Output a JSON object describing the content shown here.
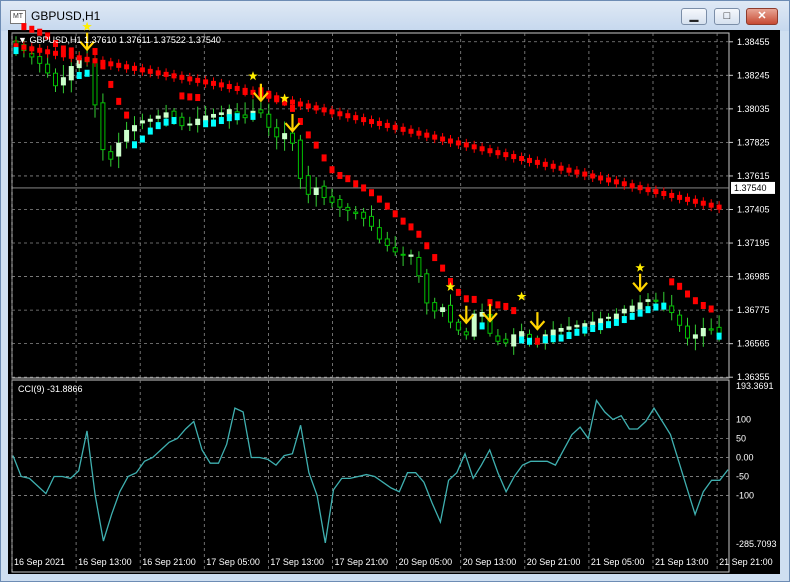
{
  "window": {
    "title": "GBPUSD,H1",
    "app_icon_text": "MT",
    "minimize_glyph": "▁",
    "maximize_glyph": "□",
    "close_glyph": "✕",
    "icons": [
      "chart-window-icon",
      "minimize-icon",
      "maximize-icon",
      "close-icon"
    ]
  },
  "chart_header": {
    "collapse_glyph": "▼",
    "ohlc_text": "GBPUSD,H1  1.37610 1.37611 1.37522 1.37540"
  },
  "cci_header": {
    "text": "CCI(9) -31.8866"
  },
  "colors": {
    "background": "#000000",
    "grid": "#8a8a8a",
    "bull_candle": "#ccffcc",
    "bull_wick": "#32cd32",
    "bear_candle": "#00c000",
    "band_red": "#ff0000",
    "band_cyan": "#00ffff",
    "signal_arrow": "#ffd400",
    "signal_star": "#ffee00",
    "cci_line": "#3fb0b0",
    "current_price_line": "#9a9a9a"
  },
  "chart_data": [
    {
      "type": "candlestick",
      "symbol": "GBPUSD",
      "timeframe": "H1",
      "ylim": [
        1.3635,
        1.3851
      ],
      "price_ticks": [
        "1.38455",
        "1.38245",
        "1.38035",
        "1.37825",
        "1.37615",
        "1.37405",
        "1.37195",
        "1.36985",
        "1.36775",
        "1.36565",
        "1.36355"
      ],
      "current_price": "1.37540",
      "time_ticks": [
        "16 Sep 2021",
        "16 Sep 13:00",
        "16 Sep 21:00",
        "17 Sep 05:00",
        "17 Sep 13:00",
        "17 Sep 21:00",
        "20 Sep 05:00",
        "20 Sep 13:00",
        "20 Sep 21:00",
        "21 Sep 05:00",
        "21 Sep 13:00",
        "21 Sep 21:00"
      ],
      "close_path": [
        1.3842,
        1.384,
        1.3836,
        1.3832,
        1.3826,
        1.3818,
        1.3823,
        1.383,
        1.3835,
        1.3833,
        1.3806,
        1.3778,
        1.3772,
        1.3782,
        1.379,
        1.3793,
        1.3796,
        1.3797,
        1.3799,
        1.3801,
        1.3798,
        1.3793,
        1.3794,
        1.3797,
        1.3799,
        1.38,
        1.3801,
        1.3803,
        1.38,
        1.3798,
        1.3802,
        1.3801,
        1.3792,
        1.3786,
        1.3788,
        1.3782,
        1.376,
        1.375,
        1.3754,
        1.3748,
        1.3745,
        1.3742,
        1.374,
        1.3738,
        1.3735,
        1.373,
        1.3722,
        1.3718,
        1.3714,
        1.3712,
        1.3712,
        1.3699,
        1.3682,
        1.3677,
        1.3679,
        1.367,
        1.3665,
        1.3662,
        1.3675,
        1.3676,
        1.3663,
        1.3658,
        1.3657,
        1.3662,
        1.3664,
        1.3659,
        1.3658,
        1.3662,
        1.3665,
        1.3666,
        1.3667,
        1.3668,
        1.3669,
        1.367,
        1.3672,
        1.3673,
        1.3675,
        1.3678,
        1.368,
        1.3682,
        1.3684,
        1.3683,
        1.3681,
        1.3676,
        1.3668,
        1.366,
        1.3662,
        1.3666,
        1.3665,
        1.3663
      ],
      "upper_band": [
        1.3843,
        1.3742
      ],
      "lower_band": [
        1.383,
        1.3663
      ],
      "arrow_count": 8,
      "star_count": 7
    },
    {
      "type": "line",
      "indicator": "CCI(9)",
      "value": "-31.8866",
      "ylim": [
        -285.7093,
        193.3691
      ],
      "y_ticks": [
        "193.3691",
        "100",
        "50",
        "0.00",
        "-50",
        "-100",
        "-285.7093"
      ],
      "values": [
        5,
        -50,
        -55,
        -75,
        -95,
        -50,
        -50,
        -55,
        -35,
        70,
        -100,
        -220,
        -150,
        -90,
        -50,
        -40,
        -10,
        0,
        20,
        40,
        50,
        75,
        95,
        20,
        -15,
        -15,
        35,
        130,
        120,
        0,
        0,
        -5,
        -20,
        5,
        10,
        85,
        -40,
        -100,
        -225,
        -85,
        -55,
        -55,
        -50,
        -45,
        -50,
        -65,
        -80,
        -90,
        -40,
        -40,
        -65,
        -120,
        -170,
        -60,
        -40,
        10,
        -55,
        -20,
        20,
        -40,
        -90,
        -50,
        -20,
        -10,
        -10,
        -10,
        -20,
        20,
        60,
        80,
        50,
        150,
        120,
        100,
        110,
        75,
        75,
        95,
        130,
        95,
        60,
        -10,
        -80,
        -150,
        -90,
        -60,
        -60,
        -32
      ]
    }
  ]
}
